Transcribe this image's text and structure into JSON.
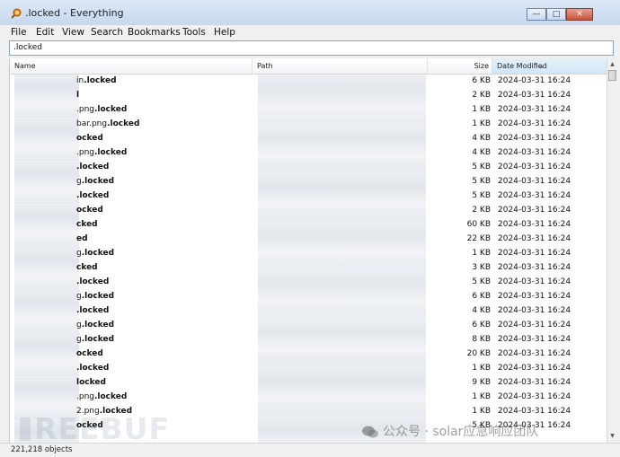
{
  "window": {
    "title": ".locked - Everything"
  },
  "menu": [
    "File",
    "Edit",
    "View",
    "Search",
    "Bookmarks",
    "Tools",
    "Help"
  ],
  "search": {
    "value": ".locked"
  },
  "columns": {
    "name": "Name",
    "path": "Path",
    "size": "Size",
    "date": "Date Modified"
  },
  "rows": [
    {
      "prefix": "in",
      "bold": ".locked",
      "size": "6 KB",
      "date": "2024-03-31 16:24"
    },
    {
      "prefix": "",
      "bold": "l",
      "size": "2 KB",
      "date": "2024-03-31 16:24"
    },
    {
      "prefix": ".png",
      "bold": ".locked",
      "size": "1 KB",
      "date": "2024-03-31 16:24"
    },
    {
      "prefix": "bar.png",
      "bold": ".locked",
      "size": "1 KB",
      "date": "2024-03-31 16:24"
    },
    {
      "prefix": "",
      "bold": "ocked",
      "size": "4 KB",
      "date": "2024-03-31 16:24"
    },
    {
      "prefix": ".png",
      "bold": ".locked",
      "size": "4 KB",
      "date": "2024-03-31 16:24"
    },
    {
      "prefix": "",
      "bold": ".locked",
      "size": "5 KB",
      "date": "2024-03-31 16:24"
    },
    {
      "prefix": "g",
      "bold": ".locked",
      "size": "5 KB",
      "date": "2024-03-31 16:24"
    },
    {
      "prefix": "",
      "bold": ".locked",
      "size": "5 KB",
      "date": "2024-03-31 16:24"
    },
    {
      "prefix": "",
      "bold": "ocked",
      "size": "2 KB",
      "date": "2024-03-31 16:24"
    },
    {
      "prefix": "",
      "bold": "cked",
      "size": "60 KB",
      "date": "2024-03-31 16:24"
    },
    {
      "prefix": "",
      "bold": "ed",
      "size": "22 KB",
      "date": "2024-03-31 16:24"
    },
    {
      "prefix": "g",
      "bold": ".locked",
      "size": "1 KB",
      "date": "2024-03-31 16:24"
    },
    {
      "prefix": "",
      "bold": "cked",
      "size": "3 KB",
      "date": "2024-03-31 16:24"
    },
    {
      "prefix": "",
      "bold": ".locked",
      "size": "5 KB",
      "date": "2024-03-31 16:24"
    },
    {
      "prefix": "g",
      "bold": ".locked",
      "size": "6 KB",
      "date": "2024-03-31 16:24"
    },
    {
      "prefix": "",
      "bold": ".locked",
      "size": "4 KB",
      "date": "2024-03-31 16:24"
    },
    {
      "prefix": "g",
      "bold": ".locked",
      "size": "6 KB",
      "date": "2024-03-31 16:24"
    },
    {
      "prefix": "g",
      "bold": ".locked",
      "size": "8 KB",
      "date": "2024-03-31 16:24"
    },
    {
      "prefix": "",
      "bold": "ocked",
      "size": "20 KB",
      "date": "2024-03-31 16:24"
    },
    {
      "prefix": "",
      "bold": ".locked",
      "size": "1 KB",
      "date": "2024-03-31 16:24"
    },
    {
      "prefix": "",
      "bold": "locked",
      "size": "9 KB",
      "date": "2024-03-31 16:24"
    },
    {
      "prefix": ".png",
      "bold": ".locked",
      "size": "1 KB",
      "date": "2024-03-31 16:24"
    },
    {
      "prefix": "2.png",
      "bold": ".locked",
      "size": "1 KB",
      "date": "2024-03-31 16:24"
    },
    {
      "prefix": "",
      "bold": "ocked",
      "size": "5 KB",
      "date": "2024-03-31 16:24"
    }
  ],
  "status": {
    "objects": "221,218 objects"
  },
  "watermark": {
    "logo": "REEBUF",
    "right": "公众号 · solar应急响应团队"
  },
  "colors": {
    "title_gradient": "#c7d8ee",
    "selection_header": "#cfe6f7",
    "close_button": "#c8523a"
  }
}
